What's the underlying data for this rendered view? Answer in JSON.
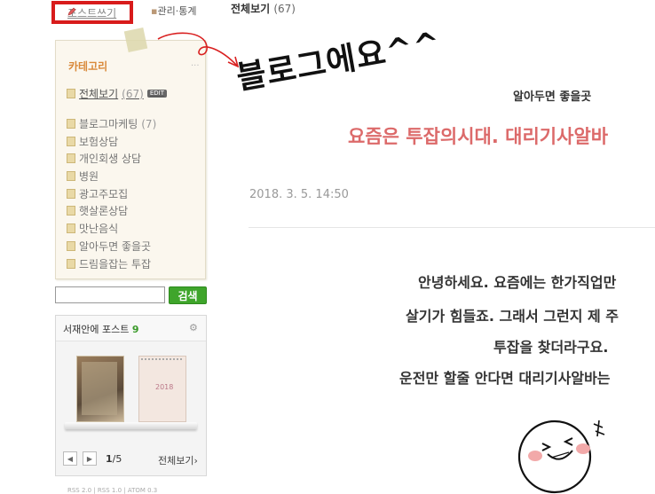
{
  "sidebar": {
    "post_write": "포스트쓰기",
    "admin": "관리·통계",
    "category": {
      "title": "카테고리",
      "collapse_icon": "...",
      "first": {
        "label": "전체보기",
        "count": "(67)",
        "badge": "EDIT"
      },
      "items": [
        {
          "label": "블로그마케팅",
          "count": "(7)"
        },
        {
          "label": "보험상담",
          "count": ""
        },
        {
          "label": "개인회생 상담",
          "count": ""
        },
        {
          "label": "병원",
          "count": ""
        },
        {
          "label": "광고주모집",
          "count": ""
        },
        {
          "label": "햇살론상담",
          "count": ""
        },
        {
          "label": "맛난음식",
          "count": ""
        },
        {
          "label": "알아두면 좋을곳",
          "count": ""
        },
        {
          "label": "드림을잡는 투잡",
          "count": ""
        }
      ]
    },
    "search": {
      "button": "검색",
      "value": ""
    },
    "widget": {
      "title": "서재안에 포스트",
      "count": "9",
      "gear_icon": "gear-icon",
      "book2_year": "2018",
      "pager_current": "1",
      "pager_total": "/5",
      "more": "전체보기›"
    },
    "bottom_strip": "RSS 2.0 | RSS 1.0 | ATOM 0.3"
  },
  "header": {
    "all_posts": "전체보기",
    "all_posts_count": "(67)"
  },
  "annotation": {
    "text": "블로그에요^^"
  },
  "post": {
    "category": "알아두면 좋을곳",
    "title": "요즘은 투잡의시대. 대리기사알바",
    "date": "2018. 3. 5. 14:50",
    "lines": [
      "안녕하세요. 요즘에는 한가직업만",
      "살기가 힘들죠. 그래서 그런지 제 주",
      "투잡을 찾더라구요.",
      "운전만 할줄 안다면 대리기사알바는"
    ]
  },
  "colors": {
    "accent_red": "#d81b1b",
    "title_pink": "#dc6a6a",
    "category_orange": "#d9893a",
    "search_green": "#3fa52b"
  }
}
